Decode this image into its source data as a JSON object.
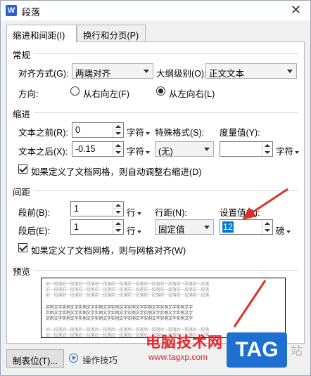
{
  "window": {
    "title": "段落",
    "app_icon": "W"
  },
  "tabs": [
    {
      "label": "缩进和间距(I)",
      "active": true
    },
    {
      "label": "换行和分页(P)",
      "active": false
    }
  ],
  "general": {
    "section_title": "常规",
    "alignment_label": "对齐方式(G):",
    "alignment_value": "两端对齐",
    "outline_label": "大纲级别(O):",
    "outline_value": "正文文本",
    "direction_label": "方向:",
    "rtl_label": "从右向左(F)",
    "ltr_label": "从左向右(L)",
    "direction_selected": "ltr"
  },
  "indent": {
    "section_title": "缩进",
    "before_label": "文本之前(R):",
    "before_value": "0",
    "before_unit": "字符",
    "after_label": "文本之后(X):",
    "after_value": "-0.15",
    "after_unit": "字符",
    "special_label": "特殊格式(S):",
    "special_value": "(无)",
    "measure_label": "度量值(Y):",
    "measure_value": "",
    "measure_unit": "字符",
    "grid_checkbox_label": "如果定义了文档网格，则自动调整右缩进(D)",
    "grid_checked": true
  },
  "spacing": {
    "section_title": "间距",
    "before_label": "段前(B):",
    "before_value": "1",
    "before_unit": "行",
    "after_label": "段后(E):",
    "after_value": "1",
    "after_unit": "行",
    "line_spacing_label": "行距(N):",
    "line_spacing_value": "固定值",
    "set_value_label": "设置值(A):",
    "set_value": "12",
    "set_value_unit": "磅",
    "grid_checkbox_label": "如果定义了文档网格，则与网格对齐(W)",
    "grid_checked": true
  },
  "preview": {
    "section_title": "预览",
    "prev_para": "前一段落前一段落前一段落前一段落前一段落前一段落前一段落前一段落前一段落前一段落",
    "sample_text": "实例文字实例文字实例文字实例文字实例文字实例文字实例文字实例文字实例文字",
    "next_para": "后一段落后一段落后一段落后一段落后一段落后一段落后一段落后一段落后一段落后一段落"
  },
  "footer": {
    "tabs_button": "制表位(T)...",
    "tips_label": "操作技巧"
  },
  "watermark": {
    "text": "电脑技术网",
    "url": "www.tagxp.com",
    "tag": "TAG",
    "site_suffix": "站"
  },
  "colors": {
    "arrow": "#d9322b",
    "selection": "#0078d7",
    "watermark_red": "#e3262b",
    "tag_blue": "#1d6fd0"
  }
}
